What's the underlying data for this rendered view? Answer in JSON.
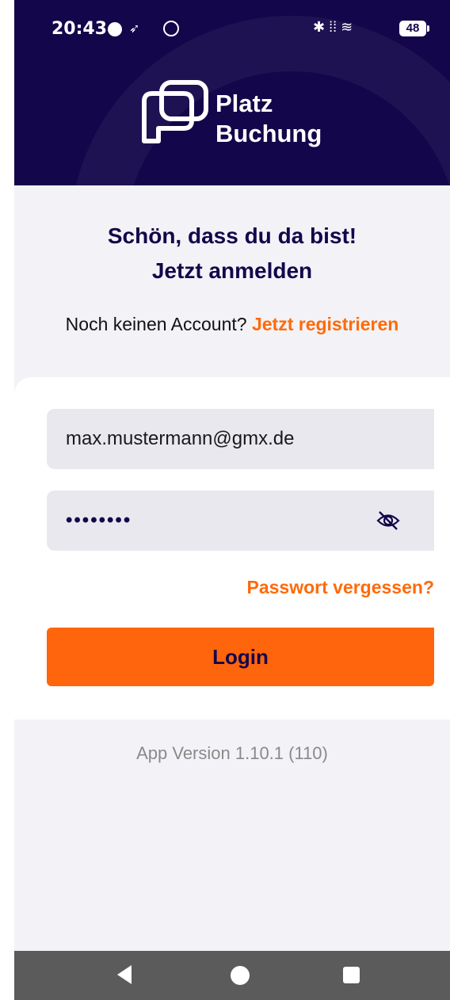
{
  "status_bar": {
    "time": "20:43",
    "battery": "48"
  },
  "brand": {
    "line1": "Platz",
    "line2": "Buchung"
  },
  "welcome": {
    "line1": "Schön, dass du da bist!",
    "line2": "Jetzt anmelden"
  },
  "register": {
    "prompt": "Noch keinen Account?",
    "link": "Jetzt registrieren"
  },
  "form": {
    "email_value": "max.mustermann@gmx.de",
    "password_masked": "••••••••",
    "forgot_label": "Passwort vergessen?",
    "login_label": "Login"
  },
  "footer": {
    "version": "App Version 1.10.1 (110)"
  },
  "colors": {
    "header_bg": "#14064a",
    "accent": "#ff650c",
    "screen_bg": "#f3f2f7"
  },
  "icons": [
    "platzbuchung-logo-icon",
    "eye-off-icon",
    "bluetooth-icon",
    "wifi-icon",
    "battery-icon",
    "back-icon",
    "home-icon",
    "recents-icon"
  ]
}
